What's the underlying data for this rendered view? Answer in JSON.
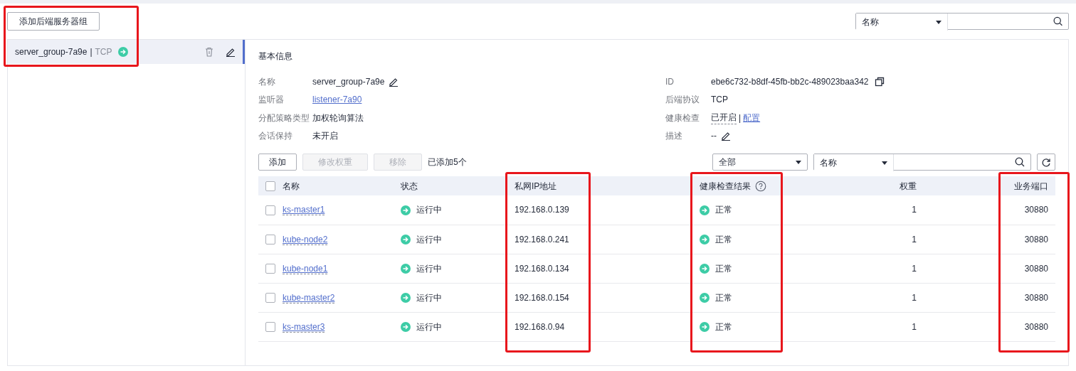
{
  "top_search": {
    "field_select": "名称"
  },
  "sidebar": {
    "add_button": "添加后端服务器组",
    "highlighted": true,
    "items": [
      {
        "name": "server_group-7a9e",
        "separator": "|",
        "protocol": "TCP",
        "selected": true
      }
    ]
  },
  "basic_info": {
    "title": "基本信息",
    "left": [
      {
        "label": "名称",
        "value": "server_group-7a9e",
        "kind": "editable"
      },
      {
        "label": "监听器",
        "value": "listener-7a90",
        "kind": "link"
      },
      {
        "label": "分配策略类型",
        "value": "加权轮询算法",
        "kind": "text"
      },
      {
        "label": "会话保持",
        "value": "未开启",
        "kind": "text"
      }
    ],
    "right": [
      {
        "label": "ID",
        "value": "ebe6c732-b8df-45fb-bb2c-489023baa342",
        "kind": "copyable"
      },
      {
        "label": "后端协议",
        "value": "TCP",
        "kind": "text"
      },
      {
        "label": "健康检查",
        "value": "已开启",
        "kind": "configurable",
        "separator": "|",
        "link": "配置"
      },
      {
        "label": "描述",
        "value": "--",
        "kind": "editable"
      }
    ]
  },
  "toolbar": {
    "buttons": [
      {
        "label": "添加",
        "disabled": false
      },
      {
        "label": "修改权重",
        "disabled": true
      },
      {
        "label": "移除",
        "disabled": true
      }
    ],
    "count": "已添加5个",
    "status_filter": "全部",
    "field_select": "名称"
  },
  "table": {
    "all_checked": false,
    "columns": [
      {
        "label": "名称",
        "highlighted": false,
        "has_help": false
      },
      {
        "label": "状态",
        "highlighted": false,
        "has_help": false
      },
      {
        "label": "私网IP地址",
        "highlighted": true,
        "has_help": false
      },
      {
        "label": "健康检查结果",
        "highlighted": true,
        "has_help": true
      },
      {
        "label": "权重",
        "highlighted": false,
        "has_help": false
      },
      {
        "label": "业务端口",
        "highlighted": true,
        "has_help": false
      }
    ],
    "rows": [
      {
        "checked": false,
        "name": "ks-master1",
        "status": "运行中",
        "ip": "192.168.0.139",
        "health": "正常",
        "weight": "1",
        "port": "30880"
      },
      {
        "checked": false,
        "name": "kube-node2",
        "status": "运行中",
        "ip": "192.168.0.241",
        "health": "正常",
        "weight": "1",
        "port": "30880"
      },
      {
        "checked": false,
        "name": "kube-node1",
        "status": "运行中",
        "ip": "192.168.0.134",
        "health": "正常",
        "weight": "1",
        "port": "30880"
      },
      {
        "checked": false,
        "name": "kube-master2",
        "status": "运行中",
        "ip": "192.168.0.154",
        "health": "正常",
        "weight": "1",
        "port": "30880"
      },
      {
        "checked": false,
        "name": "ks-master3",
        "status": "运行中",
        "ip": "192.168.0.94",
        "health": "正常",
        "weight": "1",
        "port": "30880"
      }
    ]
  }
}
